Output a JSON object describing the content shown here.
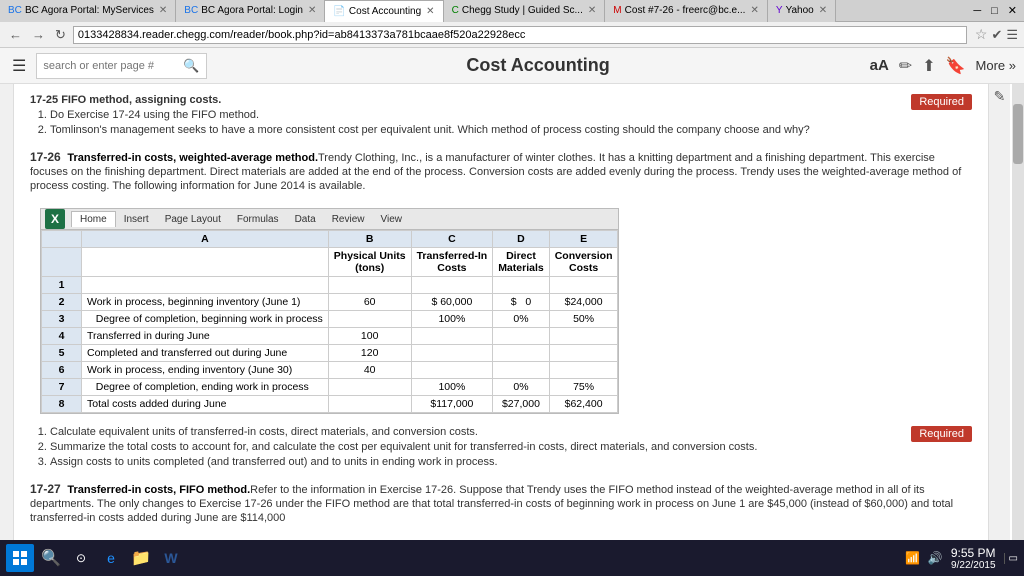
{
  "tabs": [
    {
      "label": "BC Agora Portal: MyServices",
      "active": false
    },
    {
      "label": "BC Agora Portal: Login",
      "active": false
    },
    {
      "label": "Cost Accounting",
      "active": true
    },
    {
      "label": "Chegg Study | Guided Sc...",
      "active": false
    },
    {
      "label": "Cost #7-26 - freerc@bc.e...",
      "active": false
    },
    {
      "label": "Yahoo",
      "active": false
    }
  ],
  "address_bar": {
    "url": "0133428834.reader.chegg.com/reader/book.php?id=ab8413373a781bcaae8f520a22928ecc"
  },
  "toolbar": {
    "search_placeholder": "search or enter page #",
    "title": "Cost Accounting",
    "more_label": "More »",
    "aa_label": "aA"
  },
  "fifo_section": {
    "title": "17-25  FIFO method, assigning costs.",
    "items": [
      "Do Exercise 17-24 using the FIFO method.",
      "Tomlinson's management seeks to have a more consistent cost per equivalent unit. Which method of process costing should the company choose and why?"
    ],
    "required": "Required"
  },
  "problem_17_26": {
    "number": "17-26",
    "title_bold": "Transferred-in costs, weighted-average method.",
    "body": "Trendy Clothing, Inc., is a manufacturer of winter clothes. It has a knitting department and a finishing department. This exercise focuses on the finishing department. Direct materials are added at the end of the process. Conversion costs are added evenly during the process. Trendy uses the weighted-average method of process costing. The following information for June 2014 is available."
  },
  "excel": {
    "logo": "X",
    "tabs": [
      "Home",
      "Insert",
      "Page Layout",
      "Formulas",
      "Data",
      "Review",
      "View"
    ],
    "col_headers": [
      "",
      "A",
      "B",
      "C",
      "D",
      "E"
    ],
    "sub_headers": [
      "",
      "",
      "Physical Units (tons)",
      "Transferred-In Costs",
      "Direct Materials",
      "Conversion Costs"
    ],
    "rows": [
      {
        "num": "1",
        "a": "",
        "b": "",
        "c": "",
        "d": "",
        "e": ""
      },
      {
        "num": "2",
        "a": "Work in process, beginning inventory (June 1)",
        "b": "60",
        "c": "$ 60,000",
        "d": "$    0",
        "e": "$24,000"
      },
      {
        "num": "3",
        "a": "Degree of completion, beginning work in process",
        "b": "",
        "c": "100%",
        "d": "0%",
        "e": "50%"
      },
      {
        "num": "4",
        "a": "Transferred in during June",
        "b": "100",
        "c": "",
        "d": "",
        "e": ""
      },
      {
        "num": "5",
        "a": "Completed and transferred out during June",
        "b": "120",
        "c": "",
        "d": "",
        "e": ""
      },
      {
        "num": "6",
        "a": "Work in process, ending inventory (June 30)",
        "b": "40",
        "c": "",
        "d": "",
        "e": ""
      },
      {
        "num": "7",
        "a": "Degree of completion, ending work in process",
        "b": "",
        "c": "100%",
        "d": "0%",
        "e": "75%"
      },
      {
        "num": "8",
        "a": "Total costs added during June",
        "b": "",
        "c": "$117,000",
        "d": "$27,000",
        "e": "$62,400"
      }
    ]
  },
  "questions_17_26": {
    "required": "Required",
    "items": [
      "Calculate equivalent units of transferred-in costs, direct materials, and conversion costs.",
      "Summarize the total costs to account for, and calculate the cost per equivalent unit for transferred-in costs, direct materials, and conversion costs.",
      "Assign costs to units completed (and transferred out) and to units in ending work in process."
    ]
  },
  "problem_17_27": {
    "number": "17-27",
    "title_bold": "Transferred-in costs, FIFO method.",
    "body": "Refer to the information in Exercise 17-26. Suppose that Trendy uses the FIFO method instead of the weighted-average method in all of its departments. The only changes to Exercise 17-26 under the FIFO method are that total transferred-in costs of beginning work in process on June 1 are $45,000 (instead of $60,000) and total transferred-in costs added during June are $114,000"
  },
  "taskbar": {
    "time": "9:55 PM",
    "date": "9/22/2015"
  }
}
